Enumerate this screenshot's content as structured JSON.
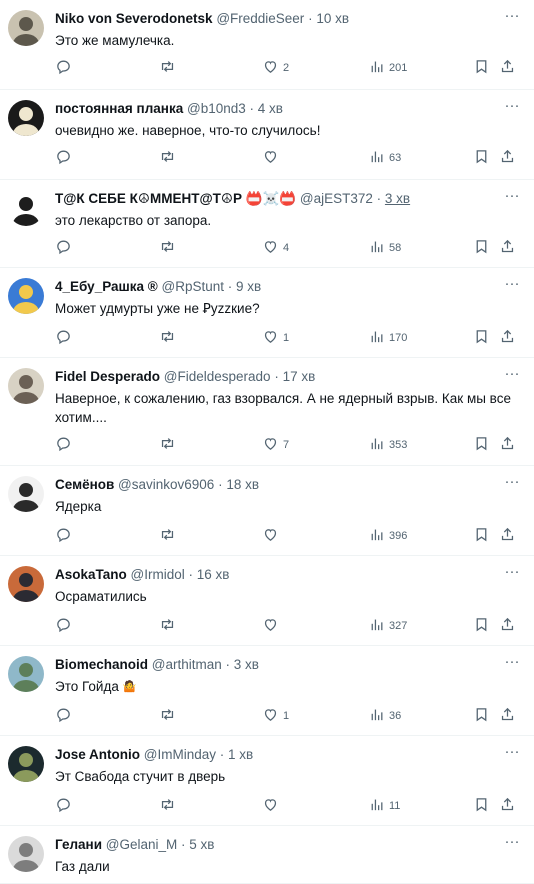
{
  "tweets": [
    {
      "name": "Niko von Severodonetsk",
      "handle": "@FreddieSeer",
      "time": "10 хв",
      "text": "Это же мамулечка.",
      "likes": "2",
      "views": "201",
      "avatar_colors": [
        "#c9c2b0",
        "#5d584c"
      ]
    },
    {
      "name": "постоянная планка",
      "handle": "@b10nd3",
      "time": "4 хв",
      "text": "очевидно же. наверное, что-то случилось!",
      "likes": "",
      "views": "63",
      "avatar_colors": [
        "#1a1a1a",
        "#efe7cf"
      ]
    },
    {
      "name": "Т@К СЕБЕ К☮ММЕНТ@Т☮Р 📛☠️📛",
      "handle": "@ajEST372",
      "time": "3 хв",
      "text": "это лекарство от запора.",
      "likes": "4",
      "views": "58",
      "avatar_colors": [
        "#ffffff",
        "#1d1d1d"
      ]
    },
    {
      "name": "4_Ебу_Рашка ®",
      "handle": "@RpStunt",
      "time": "9 хв",
      "text": "Может удмурты уже не Ꝑуzzкие?",
      "likes": "1",
      "views": "170",
      "avatar_colors": [
        "#3a7bd5",
        "#f2c94c"
      ]
    },
    {
      "name": "Fidel Desperado",
      "handle": "@Fideldesperado",
      "time": "17 хв",
      "text": "Наверное, к сожалению, газ взорвался. А не ядерный взрыв. Как мы все хотим....",
      "likes": "7",
      "views": "353",
      "avatar_colors": [
        "#d8d2c4",
        "#6b6055"
      ]
    },
    {
      "name": "Семёнов",
      "handle": "@savinkov6906",
      "time": "18 хв",
      "text": "Ядерка",
      "likes": "",
      "views": "396",
      "avatar_colors": [
        "#f1f1f1",
        "#2a2a2a"
      ]
    },
    {
      "name": "AsokaTano",
      "handle": "@Irmidol",
      "time": "16 хв",
      "text": "Осраматились",
      "likes": "",
      "views": "327",
      "avatar_colors": [
        "#c96a3a",
        "#2b2b33"
      ]
    },
    {
      "name": "Biomechanoid",
      "handle": "@arthitman",
      "time": "3 хв",
      "text": "Это Гойда",
      "emoji": "🤷",
      "likes": "1",
      "views": "36",
      "avatar_colors": [
        "#8fb8c9",
        "#5d7f5a"
      ]
    },
    {
      "name": "Jose Antonio",
      "handle": "@ImMinday",
      "time": "1 хв",
      "text": "Эт Свабода стучит в дверь",
      "likes": "",
      "views": "11",
      "avatar_colors": [
        "#1c2a2e",
        "#8b9a5c"
      ]
    },
    {
      "name": "Гелани",
      "handle": "@Gelani_M",
      "time": "5 хв",
      "text": "Газ дали",
      "likes": "",
      "views": "",
      "avatar_colors": [
        "#dadada",
        "#7d7d7d"
      ]
    }
  ],
  "icons": {
    "more": "more-icon",
    "reply": "reply-icon",
    "retweet": "retweet-icon",
    "like": "heart-icon",
    "views": "views-icon",
    "bookmark": "bookmark-icon",
    "share": "share-icon"
  },
  "colors": {
    "text": "#0f1419",
    "muted": "#536471",
    "divider": "#eff3f4"
  }
}
